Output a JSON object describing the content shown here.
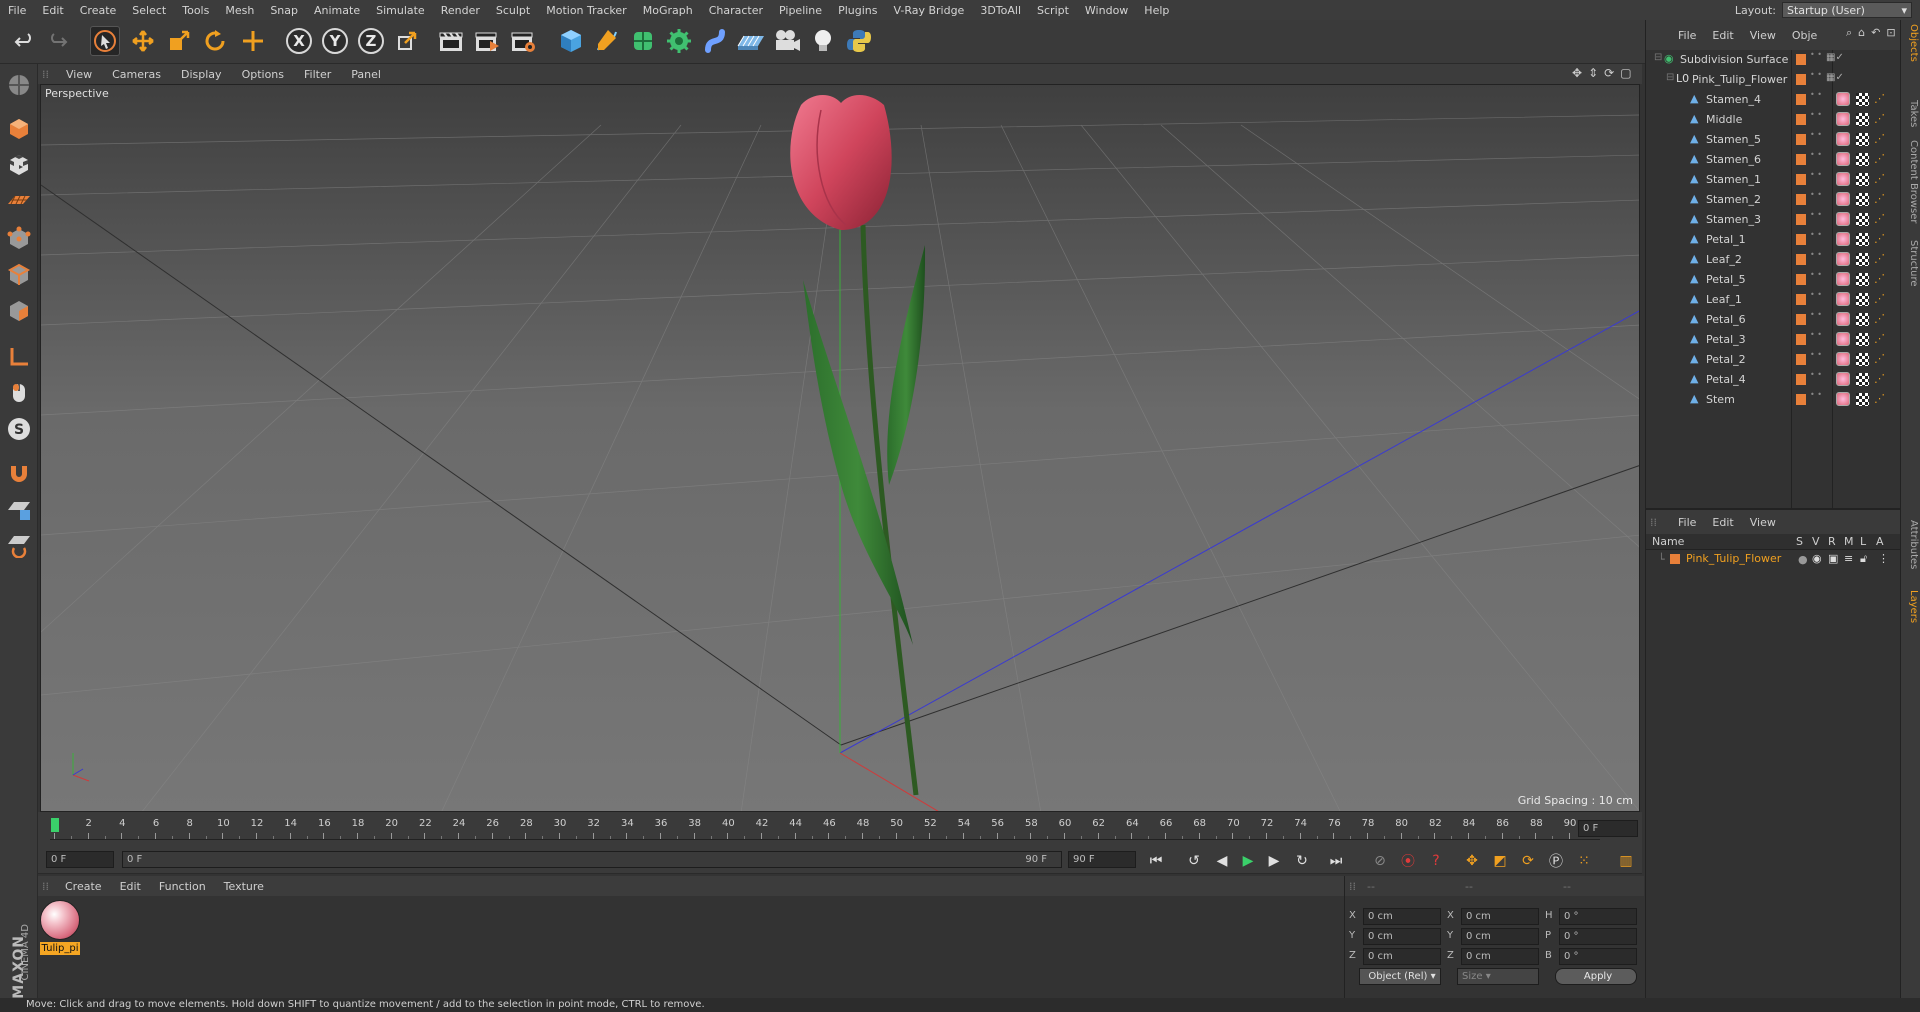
{
  "menubar": {
    "items": [
      "File",
      "Edit",
      "Create",
      "Select",
      "Tools",
      "Mesh",
      "Snap",
      "Animate",
      "Simulate",
      "Render",
      "Sculpt",
      "Motion Tracker",
      "MoGraph",
      "Character",
      "Pipeline",
      "Plugins",
      "V-Ray Bridge",
      "3DToAll",
      "Script",
      "Window",
      "Help"
    ],
    "layout_label": "Layout:",
    "layout_value": "Startup (User)"
  },
  "toolbar": {
    "axis_x": "X",
    "axis_y": "Y",
    "axis_z": "Z"
  },
  "viewport": {
    "menu": [
      "View",
      "Cameras",
      "Display",
      "Options",
      "Filter",
      "Panel"
    ],
    "label": "Perspective",
    "grid_spacing": "Grid Spacing : 10 cm"
  },
  "timeline": {
    "ticks": [
      "0",
      "2",
      "4",
      "6",
      "8",
      "10",
      "12",
      "14",
      "16",
      "18",
      "20",
      "22",
      "24",
      "26",
      "28",
      "30",
      "32",
      "34",
      "36",
      "38",
      "40",
      "42",
      "44",
      "46",
      "48",
      "50",
      "52",
      "54",
      "56",
      "58",
      "60",
      "62",
      "64",
      "66",
      "68",
      "70",
      "72",
      "74",
      "76",
      "78",
      "80",
      "82",
      "84",
      "86",
      "88",
      "90"
    ],
    "current_frame": "0 F"
  },
  "transport": {
    "start_field": "0 F",
    "range_start": "0 F",
    "range_end": "90 F",
    "end_field": "90 F"
  },
  "material_panel": {
    "menu": [
      "Create",
      "Edit",
      "Function",
      "Texture"
    ],
    "material_name": "Tulip_pi",
    "brand_top": "MAXON",
    "brand_bottom": "CINEMA 4D"
  },
  "coords": {
    "header": [
      "--",
      "--",
      "--"
    ],
    "rows": [
      {
        "a": "X",
        "av": "0 cm",
        "b": "X",
        "bv": "0 cm",
        "c": "H",
        "cv": "0 °"
      },
      {
        "a": "Y",
        "av": "0 cm",
        "b": "Y",
        "bv": "0 cm",
        "c": "P",
        "cv": "0 °"
      },
      {
        "a": "Z",
        "av": "0 cm",
        "b": "Z",
        "bv": "0 cm",
        "c": "B",
        "cv": "0 °"
      }
    ],
    "mode_select": "Object (Rel)",
    "size_select": "Size",
    "apply_label": "Apply"
  },
  "object_manager": {
    "menu": [
      "File",
      "Edit",
      "View",
      "Obje"
    ],
    "root": "Subdivision Surface",
    "group": "Pink_Tulip_Flower",
    "children": [
      "Stamen_4",
      "Middle",
      "Stamen_5",
      "Stamen_6",
      "Stamen_1",
      "Stamen_2",
      "Stamen_3",
      "Petal_1",
      "Leaf_2",
      "Petal_5",
      "Leaf_1",
      "Petal_6",
      "Petal_3",
      "Petal_2",
      "Petal_4",
      "Stem"
    ]
  },
  "layer_manager": {
    "menu": [
      "File",
      "Edit",
      "View"
    ],
    "col_name": "Name",
    "cols": [
      "S",
      "V",
      "R",
      "M",
      "L",
      "A"
    ],
    "layer_name": "Pink_Tulip_Flower"
  },
  "sidetabs": [
    "Objects",
    "Takes",
    "Content Browser",
    "Structure",
    "Attributes",
    "Layers"
  ],
  "status": "Move: Click and drag to move elements. Hold down SHIFT to quantize movement / add to the selection in point mode, CTRL to remove.",
  "colors": {
    "accent": "#e8803a",
    "material_label": "#f5a623",
    "layer_text": "#f0a020"
  }
}
